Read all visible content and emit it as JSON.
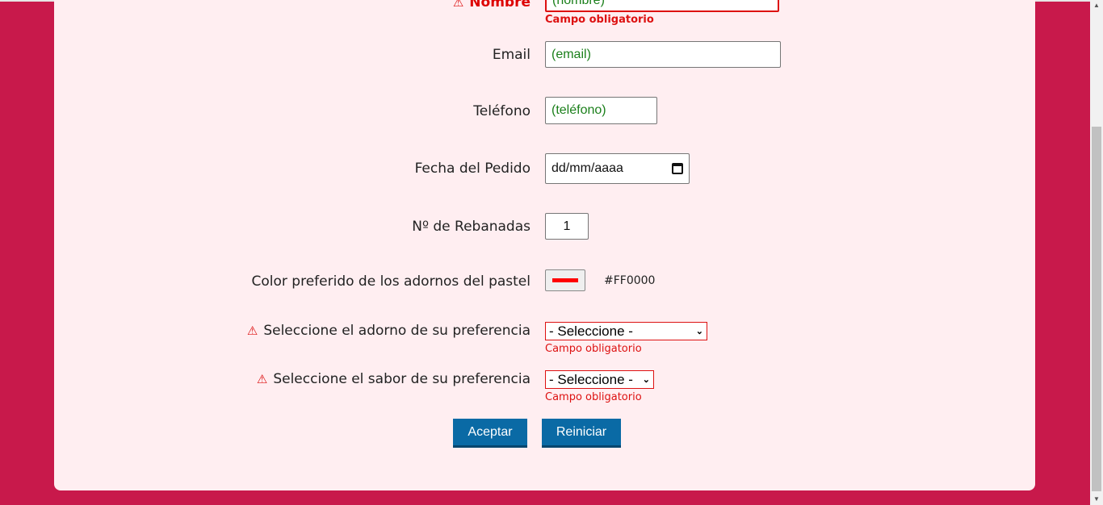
{
  "form": {
    "nombre": {
      "label": "Nombre",
      "placeholder": "(nombre)",
      "error": "Campo obligatorio"
    },
    "email": {
      "label": "Email",
      "placeholder": "(email)"
    },
    "telefono": {
      "label": "Teléfono",
      "placeholder": "(teléfono)"
    },
    "fecha": {
      "label": "Fecha del Pedido",
      "value": "dd/mm/aaaa"
    },
    "rebanadas": {
      "label": "Nº de Rebanadas",
      "value": "1"
    },
    "color": {
      "label": "Color preferido de los adornos del pastel",
      "value": "#FF0000"
    },
    "adorno": {
      "label": "Seleccione el adorno de su preferencia",
      "selected": "- Seleccione -",
      "error": "Campo obligatorio"
    },
    "sabor": {
      "label": "Seleccione el sabor de su preferencia",
      "selected": "- Seleccione -",
      "error": "Campo obligatorio"
    }
  },
  "buttons": {
    "accept": "Aceptar",
    "reset": "Reiniciar"
  },
  "icons": {
    "warning": "warning-triangle-icon",
    "calendar": "calendar-icon",
    "dropdown": "chevron-down-icon"
  },
  "colors": {
    "page_background": "#c8194b",
    "card_background": "#ffeef1",
    "error": "#dd1111",
    "button": "#0a6aa5",
    "placeholder_text": "#1a7f1a"
  }
}
